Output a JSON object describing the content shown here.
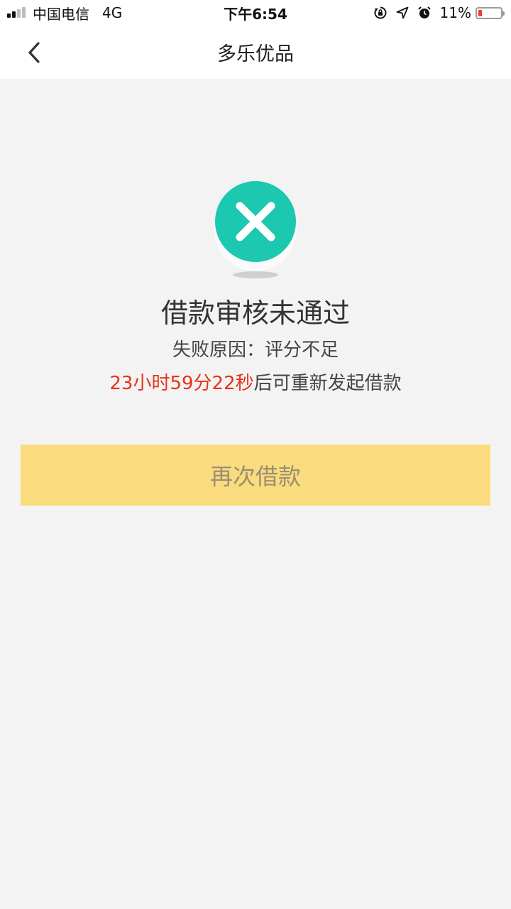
{
  "status_bar": {
    "carrier": "中国电信",
    "network": "4G",
    "time": "下午6:54",
    "battery_percent": "11%",
    "icons": [
      "orientation-lock-icon",
      "location-icon",
      "alarm-icon",
      "battery-icon"
    ],
    "battery_color": "#f23b2e"
  },
  "nav": {
    "back_icon": "chevron-left-icon",
    "title": "多乐优品"
  },
  "result": {
    "icon": "close-circle-icon",
    "icon_color": "#1cc8b0",
    "title": "借款审核未通过",
    "reason": "失败原因：评分不足",
    "countdown_time": "23小时59分22秒",
    "countdown_suffix": "后可重新发起借款",
    "countdown_color": "#e8321c"
  },
  "actions": {
    "reapply_label": "再次借款",
    "button_color": "#fadb7e"
  }
}
